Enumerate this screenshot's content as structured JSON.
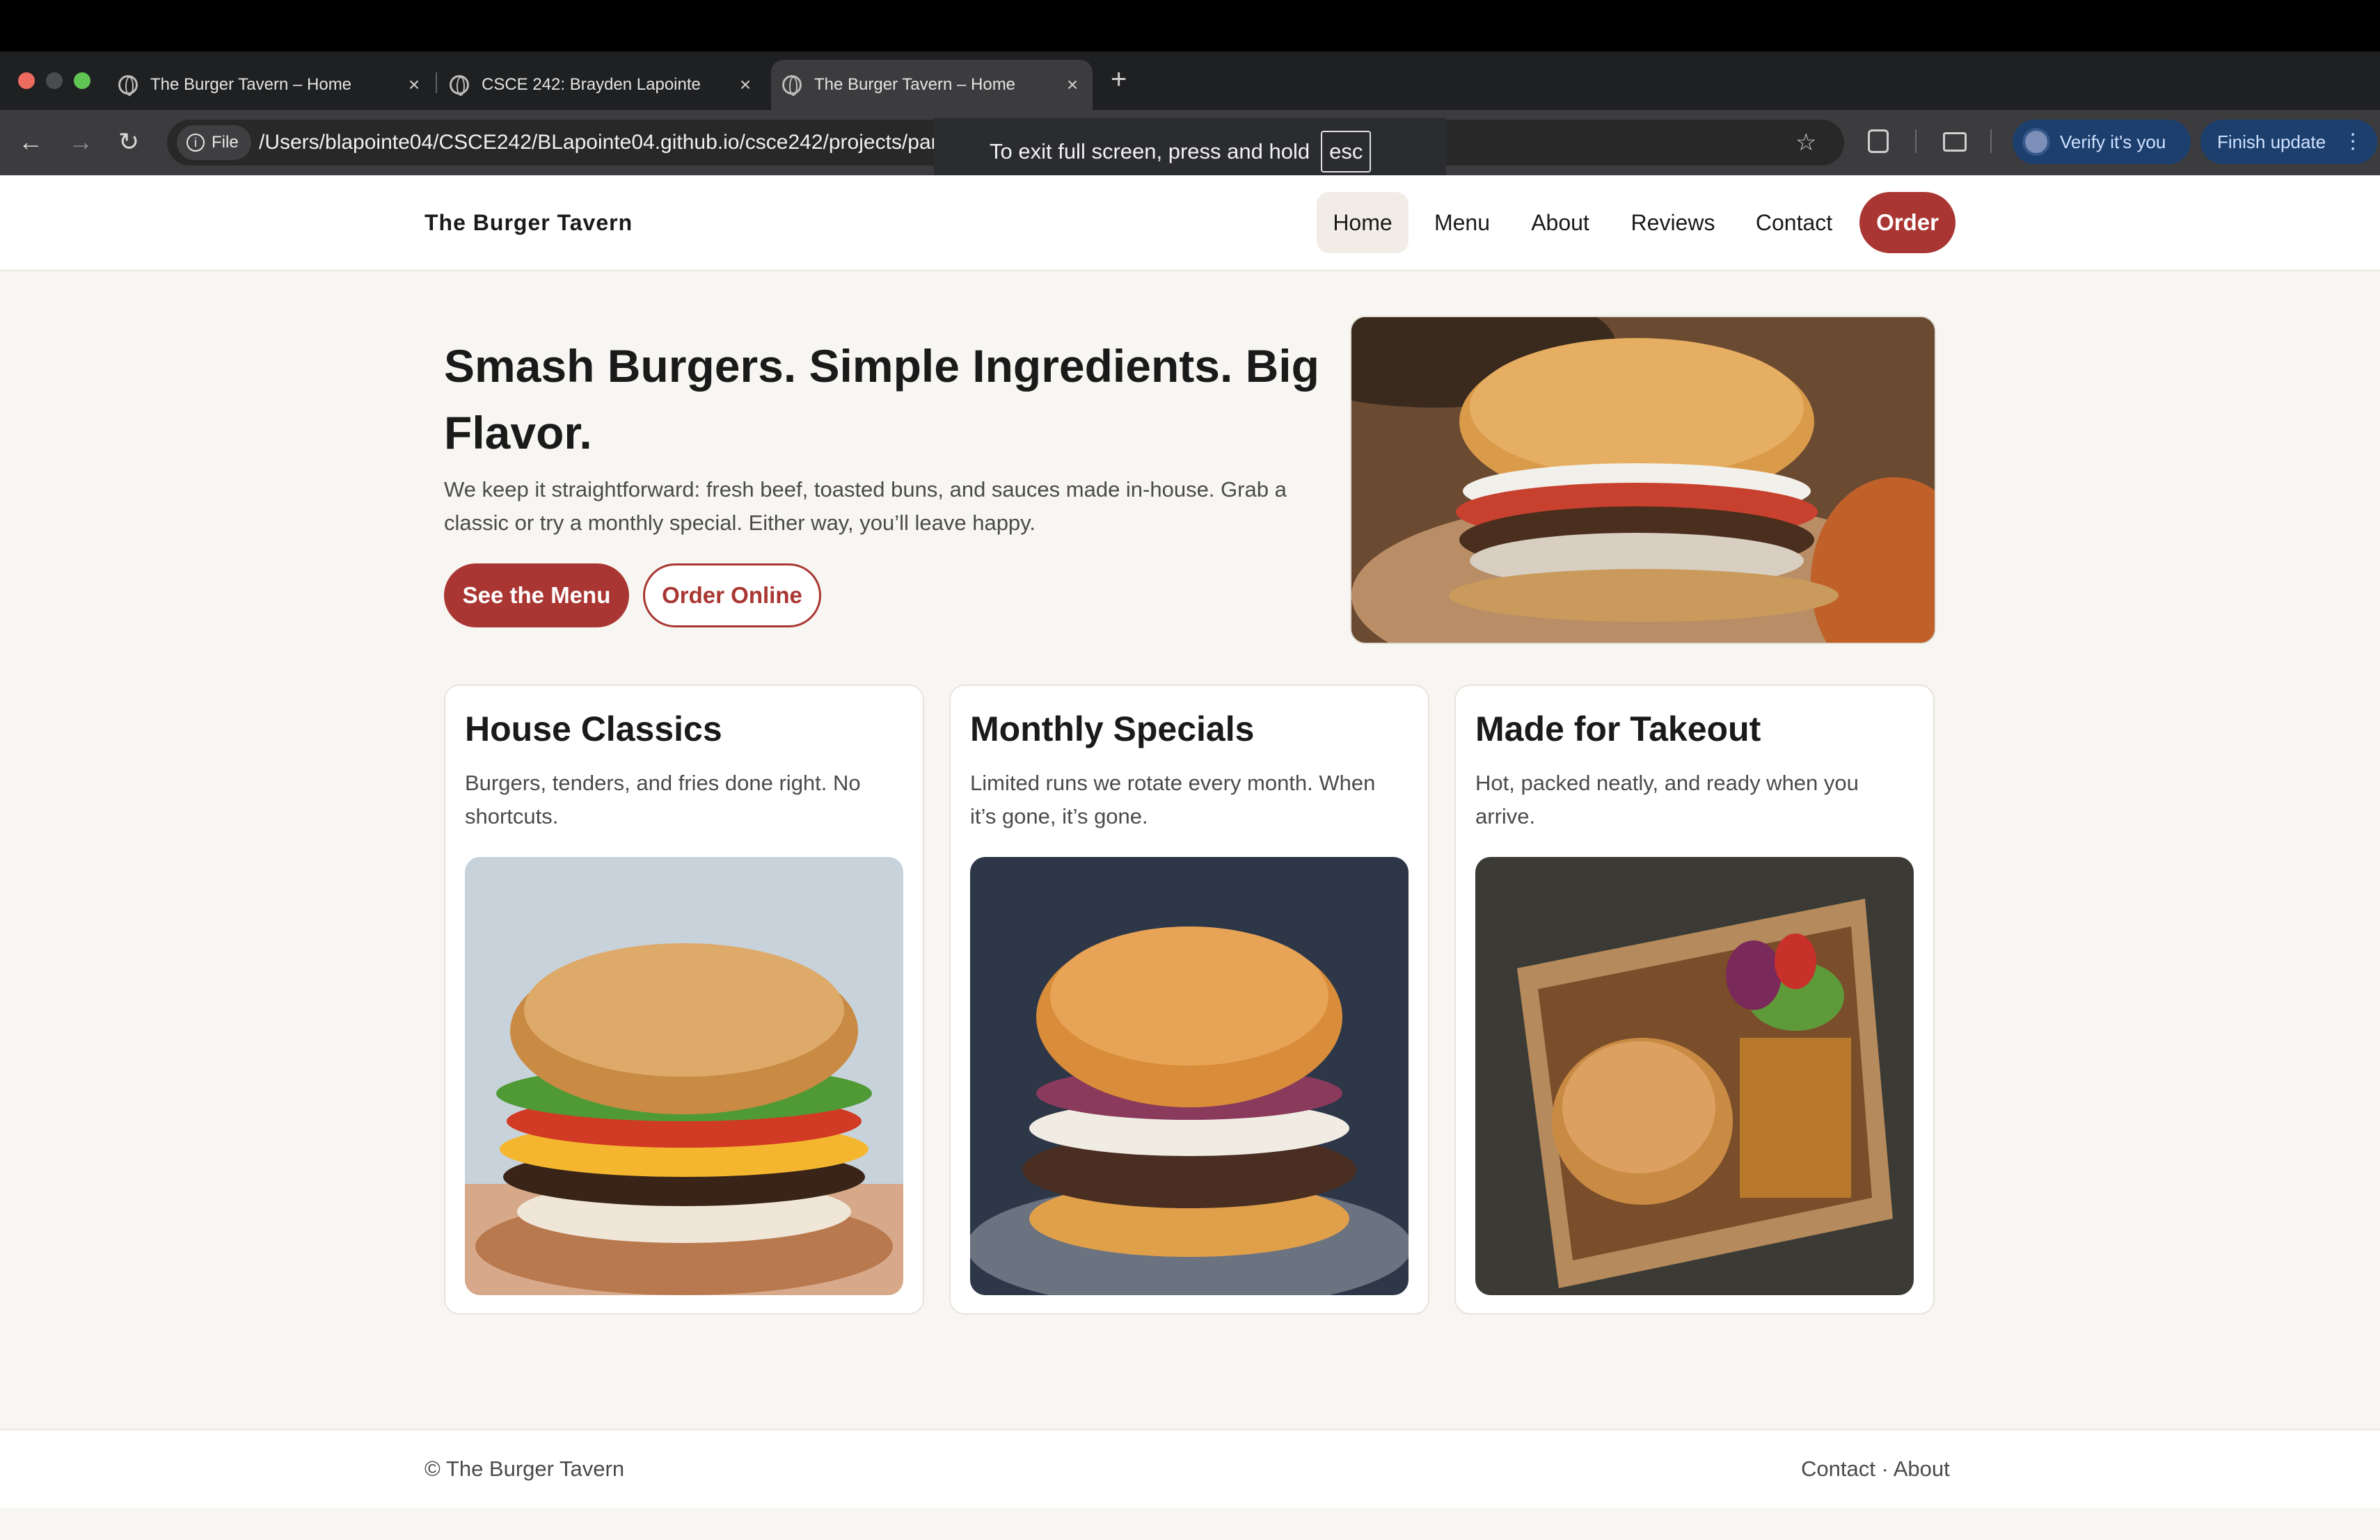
{
  "browser": {
    "tabs": [
      {
        "title": "The Burger Tavern – Home"
      },
      {
        "title": "CSCE 242: Brayden Lapointe"
      },
      {
        "title": "The Burger Tavern – Home"
      }
    ],
    "file_chip": "File",
    "url": "/Users/blapointe04/CSCE242/BLapointe04.github.io/csce242/projects/par",
    "verify_label": "Verify it's you",
    "update_label": "Finish update",
    "fullscreen_toast": "To exit full screen, press and hold",
    "fullscreen_key": "esc"
  },
  "site": {
    "brand": "The Burger Tavern",
    "nav": {
      "home": "Home",
      "menu": "Menu",
      "about": "About",
      "reviews": "Reviews",
      "contact": "Contact",
      "order": "Order"
    },
    "hero": {
      "title": "Smash Burgers. Simple Ingredients. Big Flavor.",
      "text": "We keep it straightforward: fresh beef, toasted buns, and sauces made in-house. Grab a classic or try a monthly special. Either way, you’ll leave happy.",
      "primary_button": "See the Menu",
      "secondary_button": "Order Online"
    },
    "cards": [
      {
        "title": "House Classics",
        "text": "Burgers, tenders, and fries done right. No shortcuts."
      },
      {
        "title": "Monthly Specials",
        "text": "Limited runs we rotate every month. When it’s gone, it’s gone."
      },
      {
        "title": "Made for Takeout",
        "text": "Hot, packed neatly, and ready when you arrive."
      }
    ],
    "footer": {
      "copyright": "© The Burger Tavern",
      "link_contact": "Contact",
      "separator": " · ",
      "link_about": "About"
    }
  },
  "colors": {
    "accent": "#a93632",
    "page_bg": "#f8f6f2",
    "chrome_bg": "#3c3c3f"
  },
  "icons": [
    "globe-icon",
    "close-icon",
    "plus-icon",
    "back-arrow-icon",
    "forward-arrow-icon",
    "reload-icon",
    "info-icon",
    "star-icon",
    "extension-icon",
    "cast-icon",
    "kebab-icon"
  ]
}
